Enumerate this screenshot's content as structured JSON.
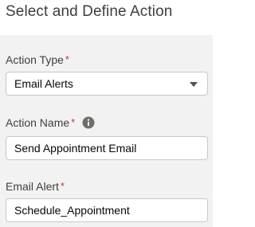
{
  "section": {
    "title": "Select and Define Action"
  },
  "fields": {
    "action_type": {
      "label": "Action Type",
      "required_mark": "*",
      "value": "Email Alerts"
    },
    "action_name": {
      "label": "Action Name",
      "required_mark": "*",
      "value": "Send Appointment Email",
      "help_icon": "info-icon"
    },
    "email_alert": {
      "label": "Email Alert",
      "required_mark": "*",
      "value": "Schedule_Appointment"
    }
  },
  "colors": {
    "required": "#c23934",
    "panel_bg": "#f3f2f2",
    "border": "#c9c7c5"
  }
}
